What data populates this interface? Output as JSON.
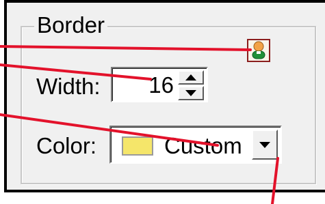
{
  "border_group": {
    "title": "Border"
  },
  "width": {
    "label": "Width:",
    "value": "16"
  },
  "color": {
    "label": "Color:",
    "selected": "Custom",
    "swatch_color": "#f5e66a"
  },
  "colors": {
    "panel_bg": "#f0f0f0",
    "accent_red": "#e3122b",
    "frame_black": "#000000"
  },
  "icons": {
    "user": "user-icon",
    "spin_up": "spin-up-icon",
    "spin_down": "spin-down-icon",
    "dropdown": "dropdown-arrow-icon"
  }
}
